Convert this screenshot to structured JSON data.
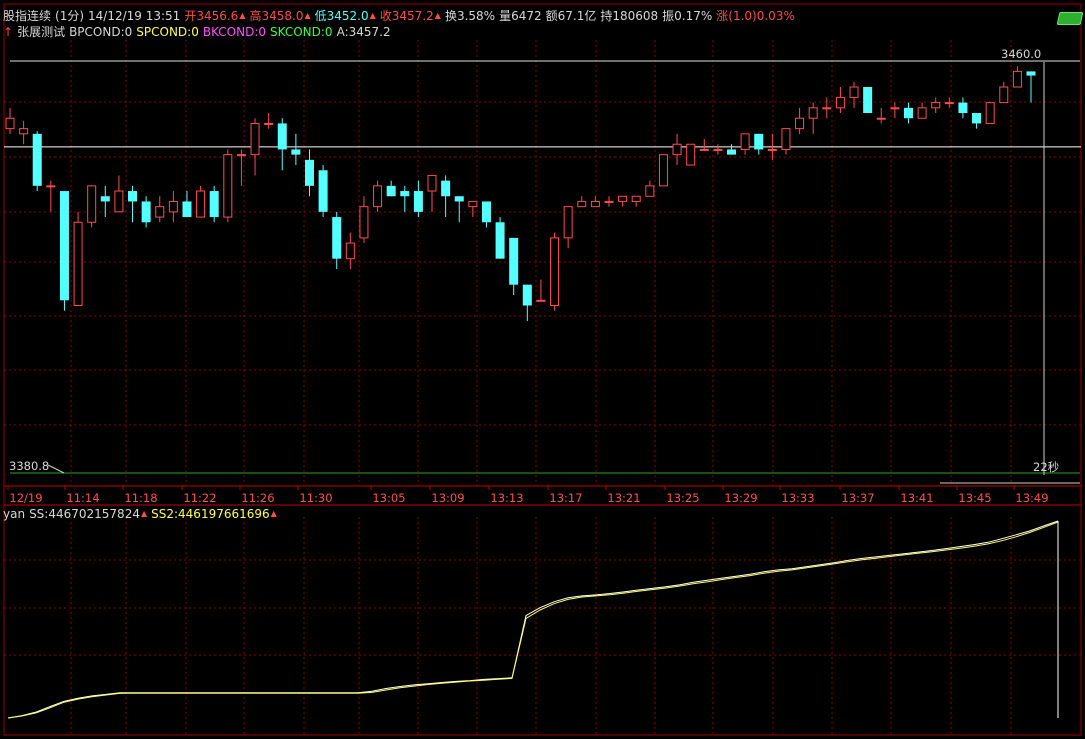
{
  "header": {
    "title": "股指连续",
    "period": "(1分)",
    "datetime": "14/12/19 13:51",
    "open": "开3456.6",
    "high": "高3458.0",
    "low": "低3452.0",
    "close": "收3457.2",
    "turnover": "换3.58%",
    "volume": "量6472",
    "amount": "额67.1亿",
    "position": "持180608",
    "amplitude": "振0.17%",
    "change": "涨(1.0)0.03%"
  },
  "indicator_line": {
    "arrow": "↑",
    "name": "张展测试",
    "bp": "BPCOND:0",
    "sp": "SPCOND:0",
    "bk": "BKCOND:0",
    "sk": "SKCOND:0",
    "a": "A:3457.2"
  },
  "price_labels": {
    "top": "3460.0",
    "bottom": "3380.8",
    "countdown": "22秒"
  },
  "sub_header": {
    "name": "yan",
    "ss": "SS:446702157824",
    "ss2": "SS2:446197661696"
  },
  "colors": {
    "up": "#ff4b4b",
    "down": "#54ffff",
    "grid": "#8a0000",
    "ss": "#ffffff",
    "ss2": "#ffff4f",
    "lowline": "#1fa81f"
  },
  "chart_data": [
    {
      "type": "candlestick",
      "x_labels": [
        "12/19",
        "11:14",
        "11:18",
        "11:22",
        "11:26",
        "11:30",
        "13:05",
        "13:09",
        "13:13",
        "13:17",
        "13:21",
        "13:25",
        "13:29",
        "13:33",
        "13:37",
        "13:41",
        "13:45",
        "13:49"
      ],
      "ylim": [
        3380.8,
        3460.0
      ],
      "crosshair_y": 3443.5,
      "candles": [
        [
          3447,
          3449,
          3446,
          3451
        ],
        [
          3446,
          3447,
          3444,
          3448.5
        ],
        [
          3446,
          3436,
          3435,
          3446.5
        ],
        [
          3436,
          3436,
          3431,
          3437
        ],
        [
          3435,
          3414,
          3412,
          3435
        ],
        [
          3413,
          3429,
          3413,
          3431
        ],
        [
          3429,
          3436,
          3428,
          3436
        ],
        [
          3434,
          3433,
          3430,
          3436
        ],
        [
          3431,
          3435,
          3431,
          3438
        ],
        [
          3435,
          3433,
          3429,
          3436
        ],
        [
          3433,
          3429,
          3428,
          3434
        ],
        [
          3430,
          3432,
          3429,
          3434
        ],
        [
          3431,
          3433,
          3429,
          3435
        ],
        [
          3433,
          3430,
          3430,
          3435
        ],
        [
          3430,
          3435,
          3430,
          3436
        ],
        [
          3435,
          3430,
          3429,
          3436
        ],
        [
          3430,
          3442,
          3429,
          3443
        ],
        [
          3442,
          3442,
          3436,
          3443
        ],
        [
          3442,
          3448,
          3438,
          3449
        ],
        [
          3448,
          3448,
          3447,
          3450
        ],
        [
          3448,
          3443,
          3439,
          3449
        ],
        [
          3443,
          3442,
          3440,
          3446
        ],
        [
          3441,
          3436,
          3434,
          3443
        ],
        [
          3439,
          3431,
          3430,
          3440
        ],
        [
          3430,
          3422,
          3420,
          3431
        ],
        [
          3422,
          3425,
          3420,
          3427
        ],
        [
          3426,
          3432,
          3425,
          3434
        ],
        [
          3432,
          3436,
          3431,
          3437
        ],
        [
          3436,
          3434,
          3434,
          3437
        ],
        [
          3435,
          3434,
          3431,
          3436
        ],
        [
          3435,
          3431,
          3430,
          3437
        ],
        [
          3435,
          3438,
          3431,
          3438
        ],
        [
          3437,
          3434,
          3430,
          3438
        ],
        [
          3434,
          3433,
          3429,
          3434
        ],
        [
          3432,
          3433,
          3430,
          3433
        ],
        [
          3433,
          3429,
          3428,
          3433
        ],
        [
          3429,
          3422,
          3422,
          3430
        ],
        [
          3426,
          3417,
          3415,
          3426
        ],
        [
          3417,
          3413,
          3410,
          3417
        ],
        [
          3414,
          3414,
          3414,
          3418
        ],
        [
          3413,
          3426,
          3412,
          3427
        ],
        [
          3426,
          3432,
          3424,
          3432
        ],
        [
          3432,
          3433,
          3432,
          3434
        ],
        [
          3432,
          3433,
          3432,
          3434
        ],
        [
          3433,
          3433,
          3432,
          3434
        ],
        [
          3433,
          3434,
          3432,
          3434
        ],
        [
          3433,
          3434,
          3432,
          3434
        ],
        [
          3434,
          3436,
          3434,
          3437
        ],
        [
          3436,
          3442,
          3436,
          3442
        ],
        [
          3442,
          3444,
          3440,
          3446
        ],
        [
          3440,
          3444,
          3440,
          3444
        ],
        [
          3443,
          3443,
          3443,
          3445
        ],
        [
          3443,
          3443,
          3442,
          3444
        ],
        [
          3443,
          3442,
          3442,
          3444
        ],
        [
          3443,
          3446,
          3442,
          3446
        ],
        [
          3446,
          3443,
          3442,
          3446
        ],
        [
          3443,
          3443,
          3441,
          3446
        ],
        [
          3443,
          3447,
          3442,
          3447
        ],
        [
          3447,
          3449,
          3446,
          3451
        ],
        [
          3449,
          3451,
          3446,
          3452
        ],
        [
          3451,
          3451,
          3449,
          3453
        ],
        [
          3451,
          3453,
          3450,
          3455
        ],
        [
          3453,
          3455,
          3451,
          3456
        ],
        [
          3455,
          3450,
          3450,
          3455
        ],
        [
          3449,
          3449,
          3448,
          3451
        ],
        [
          3451,
          3451,
          3449,
          3452
        ],
        [
          3451,
          3449,
          3448,
          3452
        ],
        [
          3449,
          3451,
          3449,
          3452
        ],
        [
          3451,
          3452,
          3450,
          3453
        ],
        [
          3452,
          3452,
          3451,
          3453
        ],
        [
          3452,
          3450,
          3449,
          3453
        ],
        [
          3450,
          3448,
          3447,
          3450
        ],
        [
          3448,
          3452,
          3448,
          3452
        ],
        [
          3452,
          3455,
          3452,
          3456
        ],
        [
          3455,
          3458,
          3455,
          3459
        ],
        [
          3458,
          3457.2,
          3452,
          3458
        ]
      ]
    },
    {
      "type": "line",
      "x_range": [
        0,
        75
      ],
      "series": [
        {
          "name": "SS",
          "values": [
            0.0,
            0.012,
            0.03,
            0.058,
            0.085,
            0.1,
            0.112,
            0.12,
            0.128,
            0.128,
            0.128,
            0.128,
            0.128,
            0.128,
            0.128,
            0.128,
            0.128,
            0.128,
            0.128,
            0.128,
            0.128,
            0.128,
            0.128,
            0.128,
            0.128,
            0.128,
            0.136,
            0.15,
            0.16,
            0.168,
            0.174,
            0.18,
            0.186,
            0.19,
            0.196,
            0.2,
            0.204,
            0.52,
            0.56,
            0.59,
            0.61,
            0.62,
            0.625,
            0.632,
            0.64,
            0.65,
            0.658,
            0.666,
            0.676,
            0.69,
            0.7,
            0.71,
            0.72,
            0.73,
            0.742,
            0.752,
            0.758,
            0.768,
            0.778,
            0.788,
            0.8,
            0.81,
            0.818,
            0.826,
            0.834,
            0.842,
            0.85,
            0.86,
            0.87,
            0.88,
            0.892,
            0.91,
            0.93,
            0.95,
            0.975,
            1.0
          ]
        },
        {
          "name": "SS2",
          "values": [
            0.0,
            0.01,
            0.026,
            0.052,
            0.08,
            0.096,
            0.108,
            0.117,
            0.125,
            0.126,
            0.126,
            0.126,
            0.126,
            0.126,
            0.126,
            0.126,
            0.126,
            0.126,
            0.126,
            0.126,
            0.126,
            0.126,
            0.126,
            0.126,
            0.126,
            0.126,
            0.13,
            0.142,
            0.154,
            0.162,
            0.17,
            0.176,
            0.182,
            0.188,
            0.192,
            0.197,
            0.201,
            0.505,
            0.548,
            0.58,
            0.602,
            0.614,
            0.62,
            0.626,
            0.634,
            0.643,
            0.652,
            0.66,
            0.67,
            0.682,
            0.692,
            0.703,
            0.713,
            0.723,
            0.735,
            0.745,
            0.752,
            0.762,
            0.772,
            0.782,
            0.793,
            0.803,
            0.811,
            0.82,
            0.828,
            0.836,
            0.844,
            0.853,
            0.862,
            0.872,
            0.884,
            0.9,
            0.92,
            0.942,
            0.968,
            0.995
          ]
        }
      ]
    }
  ]
}
